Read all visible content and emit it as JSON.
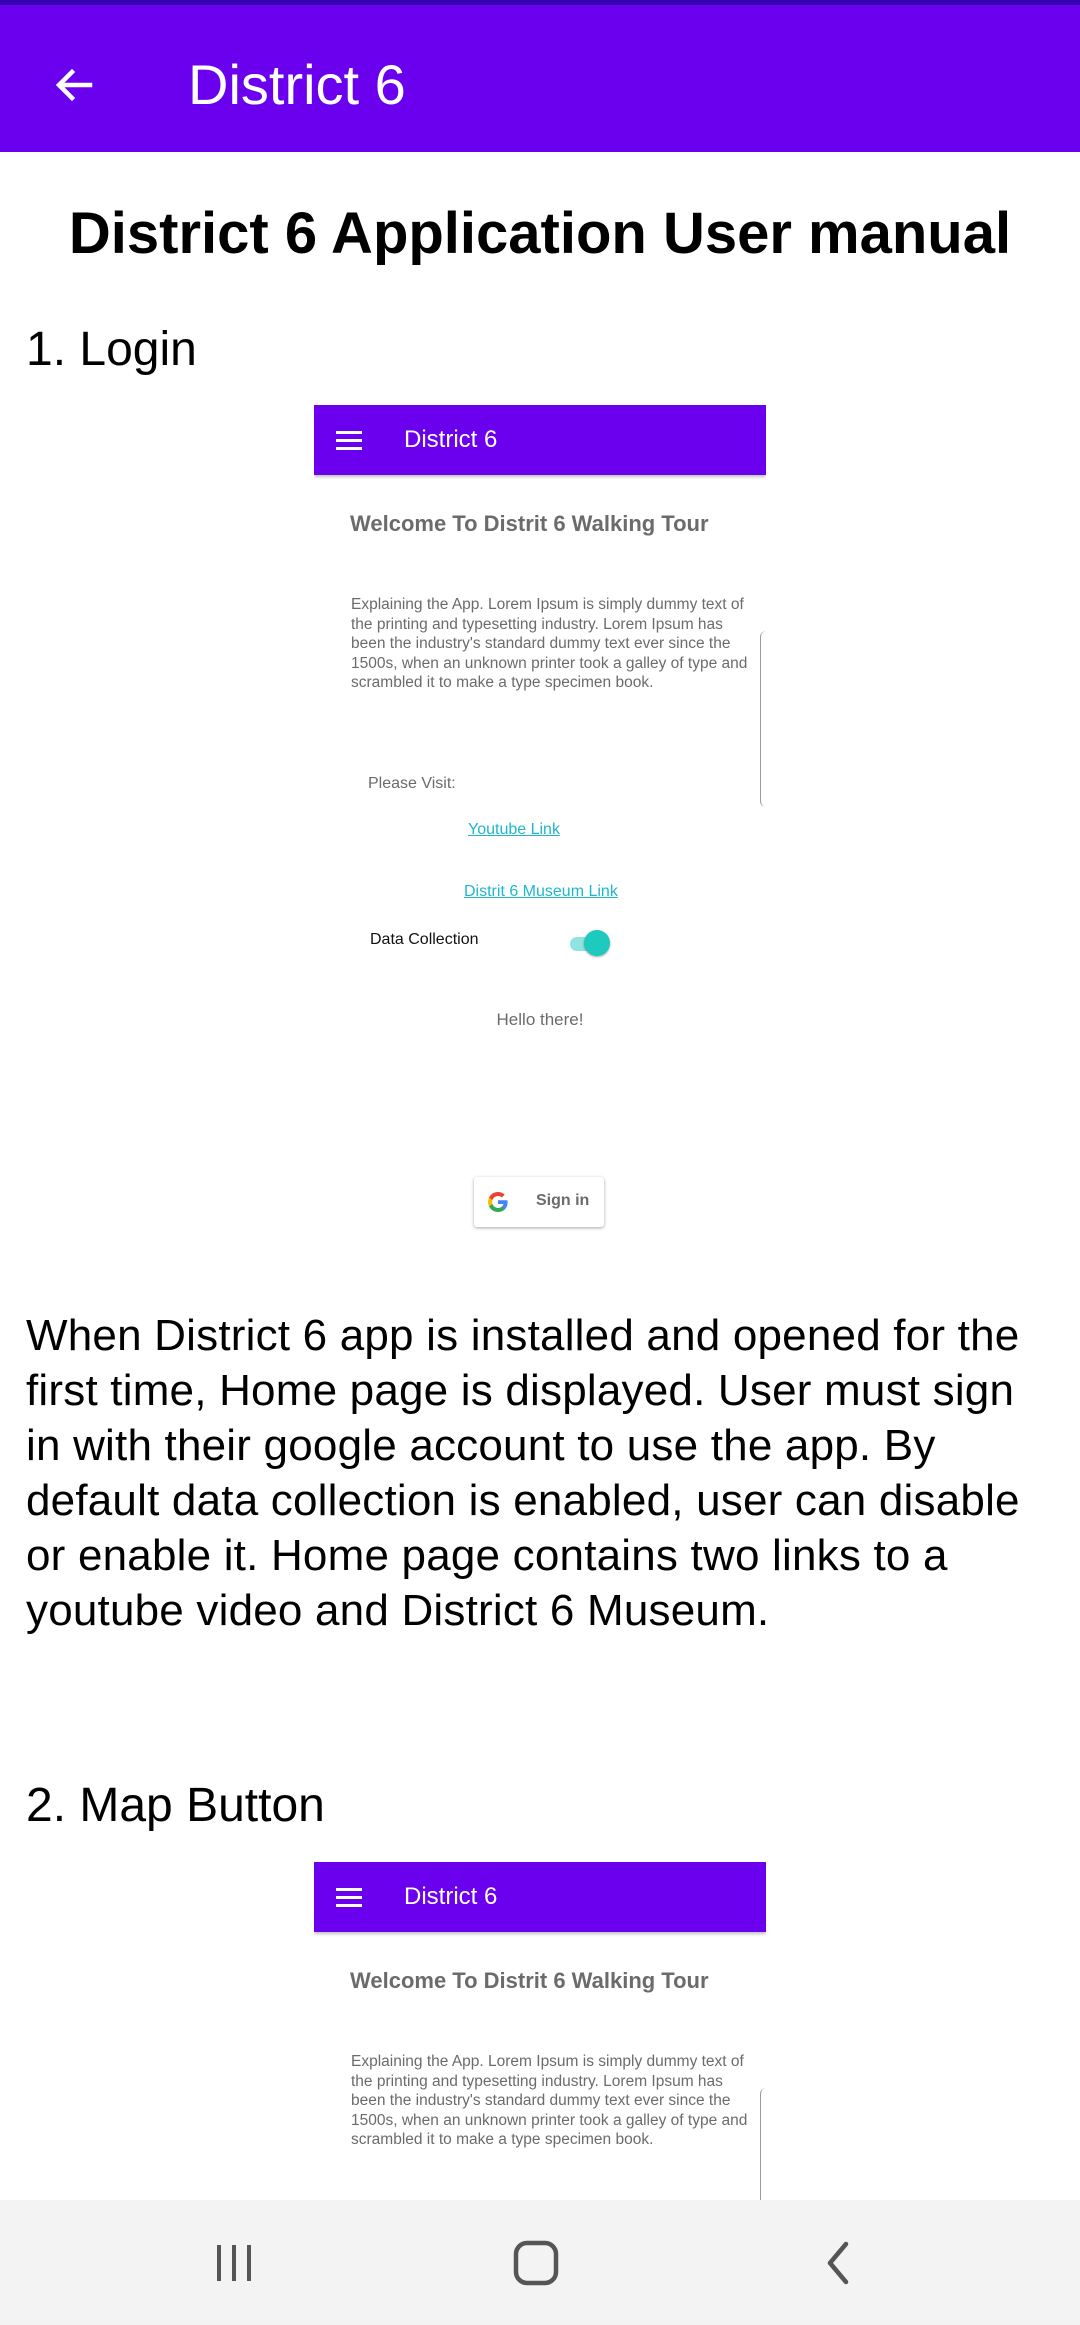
{
  "app_bar": {
    "title": "District 6",
    "back_icon": "arrow-back-icon"
  },
  "content": {
    "heading": "District 6 Application User manual",
    "sections": [
      {
        "title": "1. Login",
        "description": "When District 6 app is installed and opened for the first time, Home page is displayed. User must sign in with their google account to use the app. By default data collection is enabled, user can disable or enable it. Home page contains two links to a youtube video and District 6 Museum."
      },
      {
        "title": "2. Map Button"
      }
    ],
    "screenshot": {
      "app_title": "District 6",
      "welcome": "Welcome To Distrit 6 Walking Tour",
      "paragraph": "Explaining the App. Lorem Ipsum is simply dummy text of the printing and typesetting industry. Lorem Ipsum has been the industry's standard dummy text ever since the 1500s, when an unknown printer took a galley of type and scrambled it to make a type specimen book.",
      "please_visit": "Please Visit:",
      "youtube_link": "Youtube Link",
      "museum_link": "Distrit 6 Museum Link",
      "data_collection_label": "Data Collection",
      "data_collection_enabled": true,
      "hello": "Hello there!",
      "sign_in": "Sign in"
    }
  },
  "nav_bar": {
    "recents_icon": "recents-icon",
    "home_icon": "home-icon",
    "back_icon": "back-chevron-icon"
  },
  "colors": {
    "primary": "#6a00ee",
    "primary_dark": "#3700b3",
    "link": "#1fb8c8",
    "toggle": "#1ec9bd"
  }
}
